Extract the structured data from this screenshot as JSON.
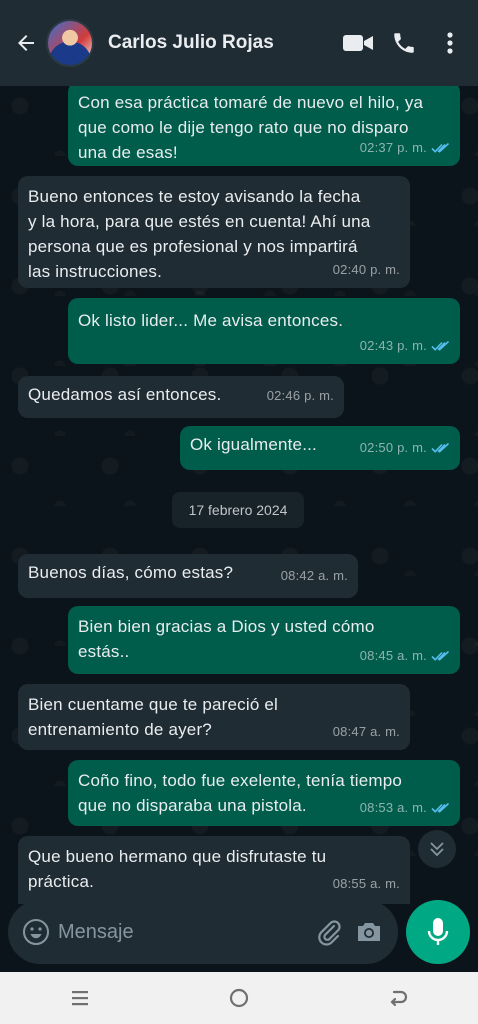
{
  "header": {
    "contact_name": "Carlos Julio Rojas"
  },
  "messages": [
    {
      "dir": "out",
      "lines": [
        "Con esa práctica tomaré de nuevo el hilo, ya",
        "que como le dije tengo rato que no disparo",
        "una de esas!"
      ],
      "time": "02:37 p. m.",
      "read": true
    },
    {
      "dir": "in",
      "lines": [
        "Bueno entonces te estoy avisando la fecha",
        "y la hora, para que estés en cuenta! Ahí una",
        "persona que es profesional y nos impartirá",
        "las instrucciones."
      ],
      "time": "02:40 p. m."
    },
    {
      "dir": "out",
      "lines": [
        "Ok listo lider... Me avisa entonces."
      ],
      "time": "02:43 p. m.",
      "read": true
    },
    {
      "dir": "in",
      "lines": [
        "Quedamos así entonces."
      ],
      "time": "02:46 p. m."
    },
    {
      "dir": "out",
      "lines": [
        "Ok igualmente..."
      ],
      "time": "02:50 p. m.",
      "read": true
    },
    {
      "dir": "in",
      "lines": [
        "Buenos días, cómo estas?"
      ],
      "time": "08:42 a. m."
    },
    {
      "dir": "out",
      "lines": [
        "Bien bien gracias a Dios y usted cómo",
        "estás.."
      ],
      "time": "08:45 a. m.",
      "read": true
    },
    {
      "dir": "in",
      "lines": [
        "Bien cuentame que te pareció el",
        "entrenamiento de ayer?"
      ],
      "time": "08:47 a. m."
    },
    {
      "dir": "out",
      "lines": [
        "Coño fino, todo fue exelente, tenía tiempo",
        "que no disparaba una pistola."
      ],
      "time": "08:53 a. m.",
      "read": true
    },
    {
      "dir": "in",
      "lines": [
        "Que bueno hermano que disfrutaste tu",
        "práctica."
      ],
      "time": "08:55 a. m."
    }
  ],
  "date_separator": "17 febrero 2024",
  "composer": {
    "placeholder": "Mensaje"
  },
  "colors": {
    "background": "#0b141a",
    "header": "#1f2c34",
    "incoming_bubble": "#202c33",
    "outgoing_bubble": "#005c4b",
    "read_ticks": "#53bdeb",
    "accent": "#00a884"
  },
  "icons": [
    "back-arrow-icon",
    "video-call-icon",
    "phone-icon",
    "more-vert-icon",
    "double-check-icon",
    "chevron-double-down-icon",
    "emoji-icon",
    "attach-icon",
    "camera-icon",
    "mic-icon",
    "recents-icon",
    "home-icon",
    "back-nav-icon"
  ]
}
